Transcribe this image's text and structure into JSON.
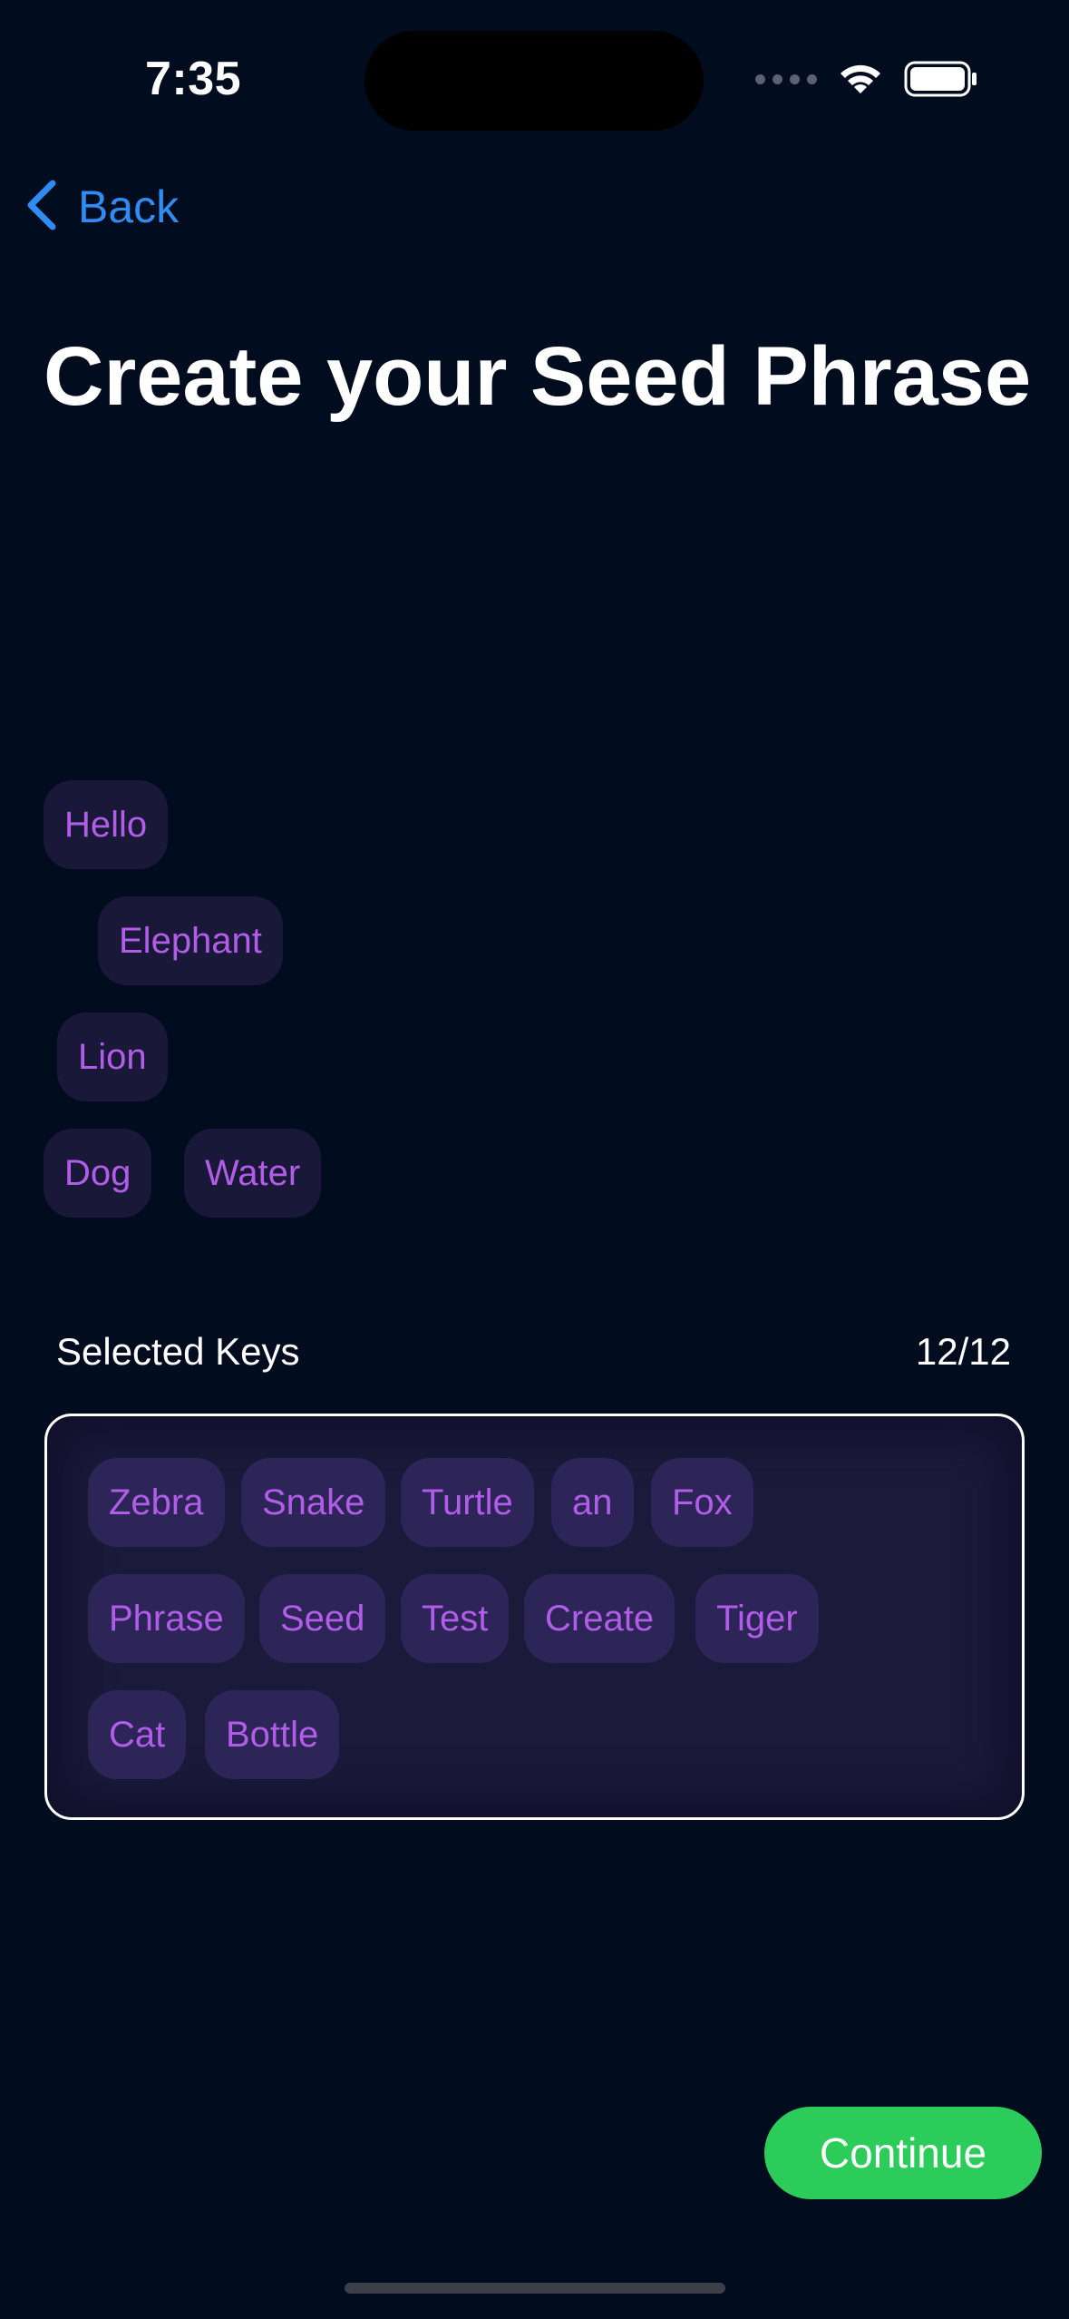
{
  "status_bar": {
    "time": "7:35",
    "icons": [
      "signal-icon",
      "wifi-icon",
      "battery-icon"
    ]
  },
  "nav": {
    "back_label": "Back",
    "back_icon": "chevron-left-icon"
  },
  "title": "Create your Seed Phrase",
  "available_words": [
    "Hello",
    "Elephant",
    "Lion",
    "Dog",
    "Water"
  ],
  "selected": {
    "label": "Selected Keys",
    "count": "12/12",
    "words": [
      "Zebra",
      "Snake",
      "Turtle",
      "an",
      "Fox",
      "Phrase",
      "Seed",
      "Test",
      "Create",
      "Tiger",
      "Cat",
      "Bottle"
    ]
  },
  "continue_label": "Continue",
  "colors": {
    "background": "#020c1f",
    "accent_blue": "#2f8cf2",
    "chip_text": "#b15de8",
    "chip_bg": "#1a1838",
    "selected_chip_bg": "#2d2458",
    "continue_green": "#2ccc5b"
  }
}
